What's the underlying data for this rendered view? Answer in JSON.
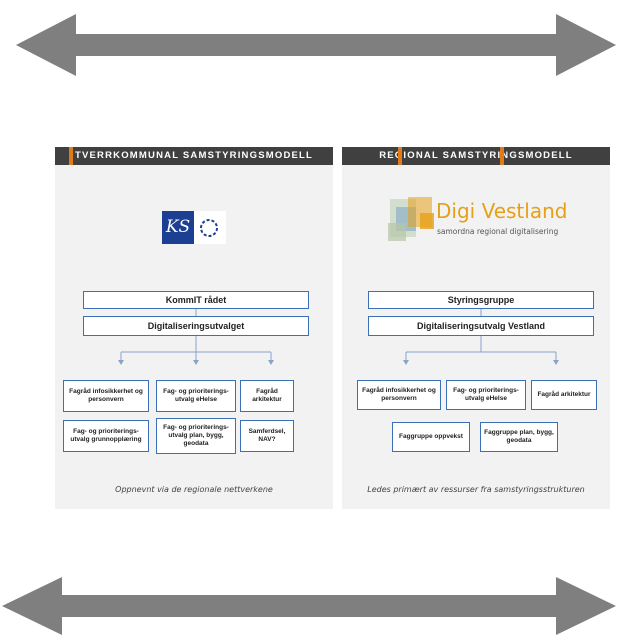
{
  "arrows": {
    "top": "double-arrow",
    "bottom": "double-arrow",
    "color": "#7f7f7f"
  },
  "left_panel": {
    "header": "TVERRKOMMUNAL SAMSTYRINGSMODELL",
    "logo_text": "KS",
    "box_top": "KommIT  rådet",
    "box_second": "Digitaliseringsutvalget",
    "row1": [
      "Fagråd infosikkerhet og personvern",
      "Fag- og prioriterings-utvalg eHelse",
      "Fagråd arkitektur"
    ],
    "row2": [
      "Fag- og prioriterings-utvalg grunnopplæring",
      "Fag- og prioriterings-utvalg plan, bygg, geodata",
      "Samferdsel, NAV?"
    ],
    "footer": "Oppnevnt via de regionale nettverkene"
  },
  "right_panel": {
    "header": "REGIONAL SAMSTYRINGSMODELL",
    "logo_title": "Digi Vestland",
    "logo_subtitle": "samordna regional digitalisering",
    "box_top": "Styringsgruppe",
    "box_second": "Digitaliseringsutvalg  Vestland",
    "row1": [
      "Fagråd infosikkerhet og personvern",
      "Fag- og prioriterings-utvalg eHelse",
      "Fagråd arkitektur"
    ],
    "row2": [
      "Faggruppe oppvekst",
      "Faggruppe plan, bygg, geodata"
    ],
    "footer": "Ledes primært av ressurser fra samstyringsstrukturen"
  },
  "colors": {
    "accent": "#e07b1a",
    "header_bg": "#404040",
    "box_border": "#3b6fb6",
    "ks_blue": "#1c3f94",
    "digi_orange": "#e6a018"
  }
}
